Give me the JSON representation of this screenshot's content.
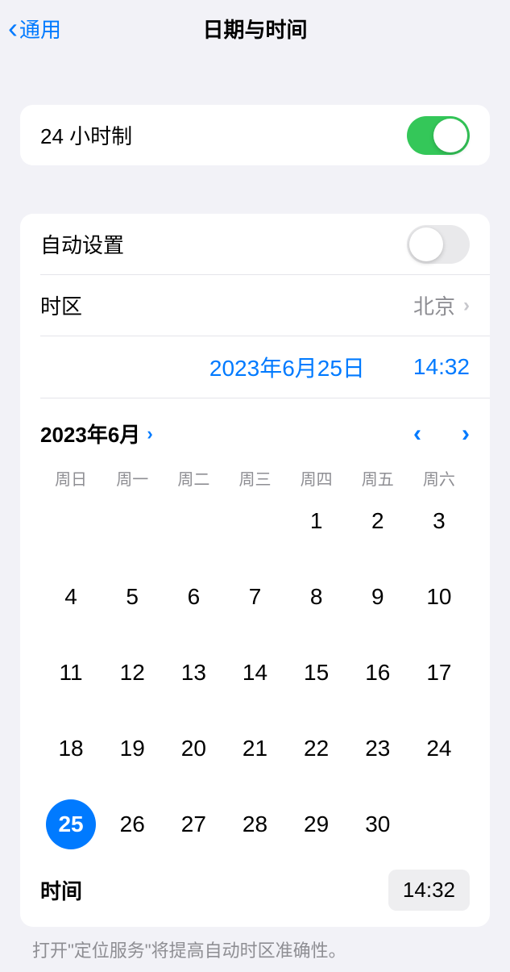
{
  "nav": {
    "back_label": "通用",
    "title": "日期与时间"
  },
  "clock24": {
    "label": "24 小时制",
    "enabled": true
  },
  "autoSet": {
    "label": "自动设置",
    "enabled": false
  },
  "timezone": {
    "label": "时区",
    "value": "北京"
  },
  "dateTimeDisplay": {
    "date": "2023年6月25日",
    "time": "14:32"
  },
  "calendar": {
    "month_year": "2023年6月",
    "weekdays": [
      "周日",
      "周一",
      "周二",
      "周三",
      "周四",
      "周五",
      "周六"
    ],
    "first_weekday_index": 4,
    "days_in_month": 30,
    "selected_day": 25
  },
  "timePicker": {
    "label": "时间",
    "value": "14:32"
  },
  "footer": {
    "note": "打开\"定位服务\"将提高自动时区准确性。"
  }
}
